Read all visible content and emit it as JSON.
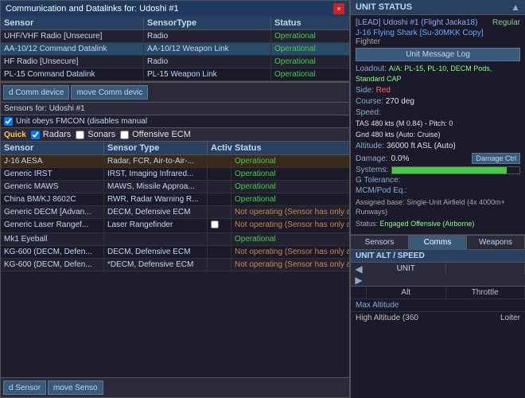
{
  "dialog": {
    "title": "Communication and Datalinks for: Udoshi #1",
    "close_btn": "×"
  },
  "upper_table": {
    "headers": [
      "Sensor",
      "SensorType",
      "Status"
    ],
    "rows": [
      {
        "sensor": "UHF/VHF Radio [Unsecure]",
        "type": "Radio",
        "status": "Operational"
      },
      {
        "sensor": "AA-10/12 Command Datalink",
        "type": "AA-10/12 Weapon Link",
        "status": "Operational"
      },
      {
        "sensor": "HF Radio [Unsecure]",
        "type": "Radio",
        "status": "Operational"
      },
      {
        "sensor": "PL-15 Command Datalink",
        "type": "PL-15 Weapon Link",
        "status": "Operational"
      }
    ]
  },
  "bottom_bar_1": {
    "btn1": "d Comm device",
    "btn2": "move Comm devic"
  },
  "sensors_for_label": "Sensors for: Udoshi #1",
  "fmcon_label": "Unit obeys FMCON (disables manual",
  "quick_label": "Quick",
  "filter_options": [
    "Radars",
    "Sonars",
    "Offensive ECM"
  ],
  "lower_table": {
    "headers": [
      "Sensor",
      "Sensor Type",
      "Activ",
      "Status"
    ],
    "rows": [
      {
        "sensor": "J-16 AESA",
        "type": "Radar, FCR, Air-to-Air-...",
        "activ": "",
        "status": "Operational",
        "selected": true
      },
      {
        "sensor": "Generic IRST",
        "type": "IRST, Imaging Infrared...",
        "activ": "",
        "status": "Operational"
      },
      {
        "sensor": "Generic MAWS",
        "type": "MAWS, Missile Approa...",
        "activ": "",
        "status": "Operational"
      },
      {
        "sensor": "China BM/KJ 8602C",
        "type": "RWR, Radar Warning R...",
        "activ": "",
        "status": "Operational"
      },
      {
        "sensor": "Generic DECM [Advan...",
        "type": "DECM, Defensive ECM",
        "activ": "",
        "status": "Not operating (Sensor has only active mo...",
        "not_op": true
      },
      {
        "sensor": "Generic Laser Rangef...",
        "type": "Laser Rangefinder",
        "activ": "☐",
        "status": "Not operating (Sensor has only active mo...",
        "not_op": true
      },
      {
        "sensor": "Mk1 Eyeball",
        "type": "",
        "activ": "",
        "status": "Operational"
      },
      {
        "sensor": "KG-600 (DECM, Defen...",
        "type": "DECM, Defensive ECM",
        "activ": "",
        "status": "Not operating (Sensor has only active mo...",
        "not_op": true
      },
      {
        "sensor": "KG-600 (DECM, Defen...",
        "type": "*DECM, Defensive ECM",
        "activ": "",
        "status": "Not operating (Sensor has only active mo...",
        "not_op": true
      }
    ]
  },
  "bottom_bar_2": {
    "btn1": "d Sensor",
    "btn2": "move Senso"
  },
  "unit_status": {
    "header": "UNIT STATUS",
    "lead": "[LEAD] Udoshi #1 (Flight Jacka18)",
    "regular": "Regular",
    "aircraft": "J-16 Flying Shark [Su-30MKK Copy]",
    "aircraft_type": "Fighter",
    "msg_log_btn": "Unit Message Log",
    "loadout_label": "Loadout:",
    "loadout_value": "A/A: PL-15, PL-10, DECM Pods, Standard CAP",
    "side_label": "Side:",
    "side_value": "Red",
    "course_label": "Course:",
    "course_value": "270 deg",
    "speed_label": "Speed:",
    "tas_value": "TAS 480 kts (M 0.84) - Pitch: 0",
    "gnd_value": "Gnd 480 kts (Auto: Cruise)",
    "altitude_label": "Altitude:",
    "altitude_value": "36000 ft ASL (Auto)",
    "damage_label": "Damage:",
    "damage_value": "0.0%",
    "damage_ctrl_btn": "Damage Ctrl",
    "systems_label": "Systems:",
    "systems_pct": 90,
    "g_tolerance_label": "G Tolerance:",
    "mcm_label": "MCM/Pod Eq.:",
    "assigned_base_label": "Assigned base:",
    "assigned_base_value": "Single-Unit Airfield (4x 4000m+ Runways)",
    "status_label": "Status:",
    "status_value": "Engaged Offensive (Airborne)"
  },
  "tabs": {
    "sensors": "Sensors",
    "comms": "Comms",
    "weapons": "Weapons",
    "active": "sensors"
  },
  "alt_speed": {
    "header": "UNIT ALT / SPEED",
    "unit_col": "UNIT",
    "alt_col": "Alt",
    "throttle_col": "Throttle",
    "max_alt_label": "Max Altitude",
    "high_alt_label": "High Altitude (360",
    "loiter_label": "Loiter"
  }
}
